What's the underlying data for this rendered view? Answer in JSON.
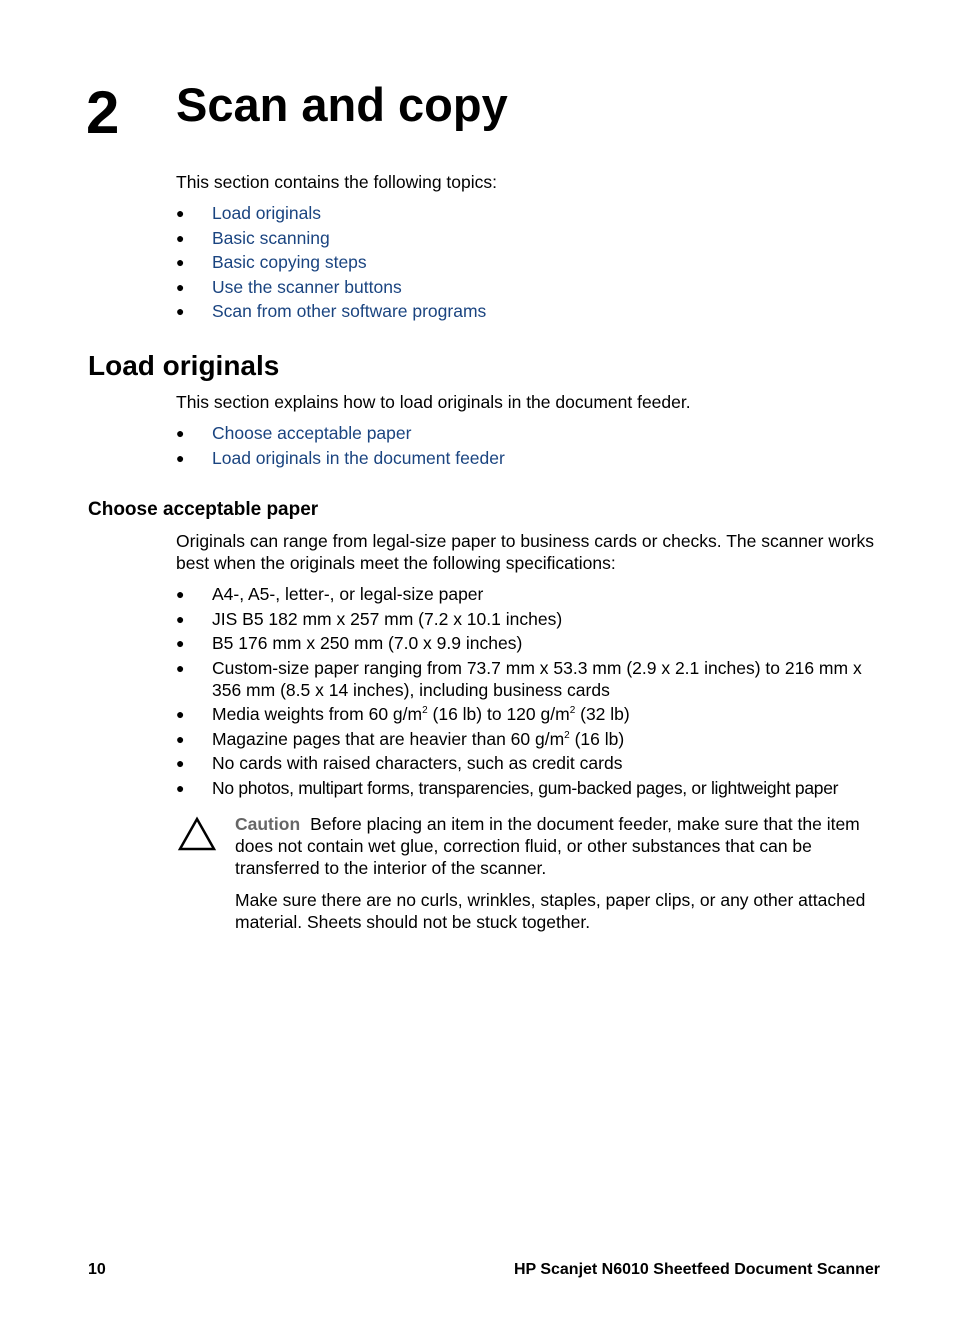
{
  "chapter": {
    "number": "2",
    "title": "Scan and copy",
    "intro": "This section contains the following topics:",
    "topics": [
      "Load originals",
      "Basic scanning",
      "Basic copying steps",
      "Use the scanner buttons",
      "Scan from other software programs"
    ]
  },
  "load_originals": {
    "heading": "Load originals",
    "intro": "This section explains how to load originals in the document feeder.",
    "links": [
      "Choose acceptable paper",
      "Load originals in the document feeder"
    ]
  },
  "choose_paper": {
    "heading": "Choose acceptable paper",
    "intro": "Originals can range from legal-size paper to business cards or checks. The scanner works best when the originals meet the following specifications:",
    "specs": [
      "A4-, A5-, letter-, or legal-size paper",
      "JIS B5 182 mm x 257 mm (7.2 x 10.1 inches)",
      "B5 176 mm x 250 mm (7.0 x 9.9 inches)",
      "Custom-size paper ranging from 73.7 mm x 53.3 mm (2.9 x 2.1 inches) to 216 mm x 356 mm (8.5 x 14 inches), including business cards"
    ],
    "media_weights": {
      "a": "Media weights from 60 g/m",
      "sup1": "2",
      "b": " (16 lb) to 120 g/m",
      "sup2": "2",
      "c": " (32 lb)"
    },
    "magazine": {
      "a": "Magazine pages that are heavier than 60 g/m",
      "sup": "2",
      "b": " (16 lb)"
    },
    "specs_tail": [
      "No cards with raised characters, such as credit cards",
      "No photos, multipart forms, transparencies, gum-backed pages, or lightweight paper"
    ],
    "caution": {
      "icon": "warning-triangle-icon",
      "label": "Caution",
      "text": "Before placing an item in the document feeder, make sure that the item does not contain wet glue, correction fluid, or other substances that can be transferred to the interior of the scanner.",
      "text2": "Make sure there are no curls, wrinkles, staples, paper clips, or any other attached material. Sheets should not be stuck together."
    }
  },
  "footer": {
    "page_number": "10",
    "product": "HP Scanjet N6010 Sheetfeed Document Scanner"
  }
}
